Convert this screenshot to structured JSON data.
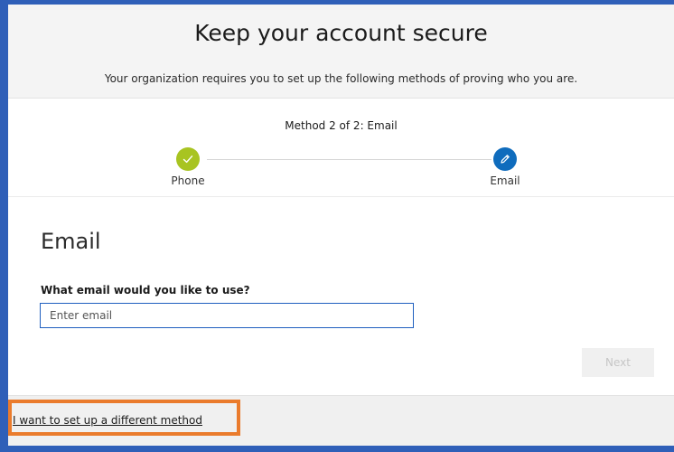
{
  "header": {
    "title": "Keep your account secure",
    "subtitle": "Your organization requires you to set up the following methods of proving who you are."
  },
  "steps": {
    "caption": "Method 2 of 2: Email",
    "items": [
      {
        "label": "Phone",
        "state": "completed",
        "icon": "check-icon",
        "color": "#a8c421"
      },
      {
        "label": "Email",
        "state": "current",
        "icon": "pencil-icon",
        "color": "#0f6cbd"
      }
    ]
  },
  "form": {
    "section_title": "Email",
    "field_label": "What email would you like to use?",
    "email_placeholder": "Enter email",
    "email_value": "",
    "next_label": "Next"
  },
  "footer": {
    "different_method_link": "I want to set up a different method"
  },
  "colors": {
    "accent": "#0f6cbd",
    "success": "#a8c421",
    "highlight": "#ea7b2c",
    "backdrop": "#2f5fb8"
  }
}
